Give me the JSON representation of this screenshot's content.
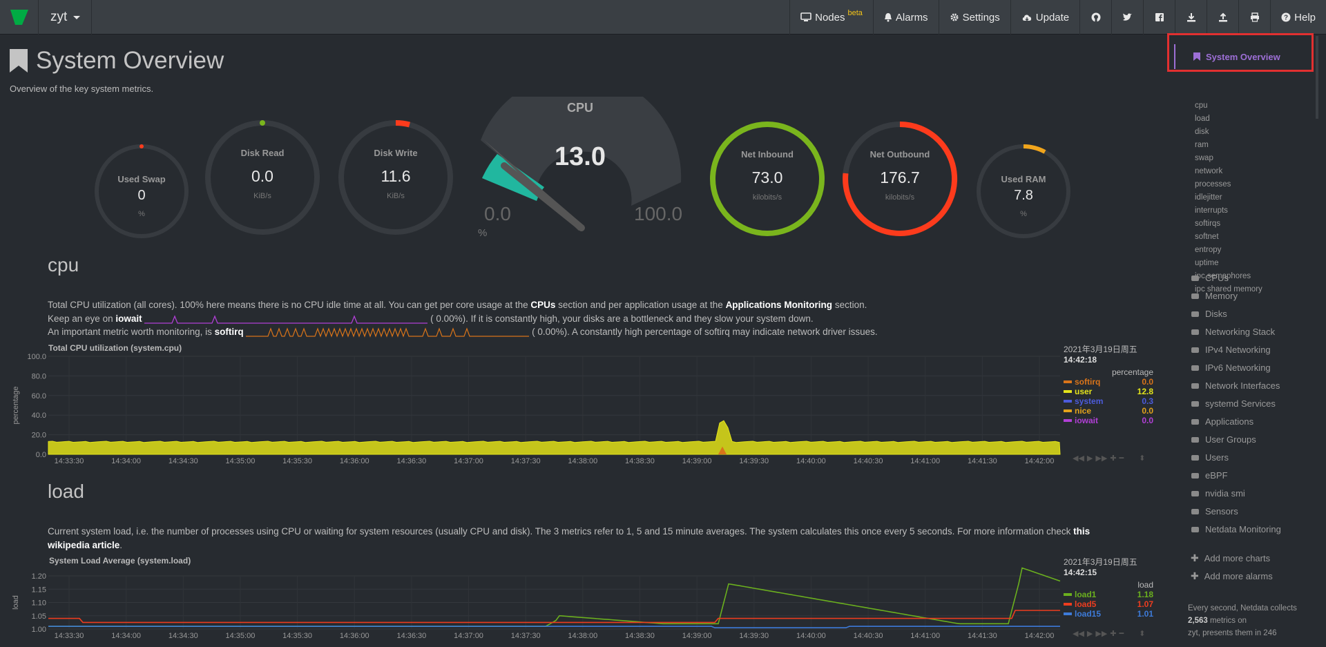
{
  "navbar": {
    "host": "zyt",
    "items": {
      "nodes": "Nodes",
      "nodes_badge": "beta",
      "alarms": "Alarms",
      "settings": "Settings",
      "update": "Update",
      "help": "Help"
    }
  },
  "page": {
    "title": "System Overview",
    "subtitle": "Overview of the key system metrics."
  },
  "gauges": {
    "used_swap": {
      "label": "Used Swap",
      "value": "0",
      "unit": "%"
    },
    "disk_read": {
      "label": "Disk Read",
      "value": "0.0",
      "unit": "KiB/s"
    },
    "disk_write": {
      "label": "Disk Write",
      "value": "11.6",
      "unit": "KiB/s"
    },
    "cpu": {
      "label": "CPU",
      "value": "13.0",
      "min": "0.0",
      "max": "100.0",
      "unit": "%",
      "level_percent": 13
    },
    "net_inbound": {
      "label": "Net Inbound",
      "value": "73.0",
      "unit": "kilobits/s"
    },
    "net_outbound": {
      "label": "Net Outbound",
      "value": "176.7",
      "unit": "kilobits/s"
    },
    "used_ram": {
      "label": "Used RAM",
      "value": "7.8",
      "unit": "%"
    }
  },
  "cpu_section": {
    "heading": "cpu",
    "line1_a": "Total CPU utilization (all cores). 100% here means there is no CPU idle time at all. You can get per core usage at the ",
    "line1_link1": "CPUs",
    "line1_b": " section and per application usage at the ",
    "line1_link2": "Applications Monitoring",
    "line1_c": " section.",
    "line2_a": "Keep an eye on ",
    "line2_b": "iowait",
    "line2_c": "(       0.00%). If it is constantly high, your disks are a bottleneck and they slow your system down.",
    "line3_a": "An important metric worth monitoring, is ",
    "line3_b": "softirq",
    "line3_c": "(       0.00%). A constantly high percentage of softirq may indicate network driver issues."
  },
  "cpu_chart": {
    "title": "Total CPU utilization (system.cpu)",
    "ylabel": "percentage",
    "yticks": [
      "100.0",
      "80.0",
      "60.0",
      "40.0",
      "20.0",
      "0.0"
    ],
    "xticks": [
      "14:33:30",
      "14:34:00",
      "14:34:30",
      "14:35:00",
      "14:35:30",
      "14:36:00",
      "14:36:30",
      "14:37:00",
      "14:37:30",
      "14:38:00",
      "14:38:30",
      "14:39:00",
      "14:39:30",
      "14:40:00",
      "14:40:30",
      "14:41:00",
      "14:41:30",
      "14:42:00"
    ],
    "date": "2021年3月19日周五",
    "time": "14:42:18",
    "units": "percentage",
    "legend": [
      {
        "name": "softirq",
        "value": "0.0",
        "color": "#d9741a"
      },
      {
        "name": "user",
        "value": "12.8",
        "color": "#e3e31b"
      },
      {
        "name": "system",
        "value": "0.3",
        "color": "#4c5bdb"
      },
      {
        "name": "nice",
        "value": "0.0",
        "color": "#e3a31b"
      },
      {
        "name": "iowait",
        "value": "0.0",
        "color": "#b13fd6"
      }
    ]
  },
  "load_section": {
    "heading": "load",
    "line1_a": "Current system load, i.e. the number of processes using CPU or waiting for system resources (usually CPU and disk). The 3 metrics refer to 1, 5 and 15 minute averages. The system calculates this once every 5 seconds. For more information check ",
    "line1_link": "this",
    "line2_link": "wikipedia article",
    "line2_end": "."
  },
  "load_chart": {
    "title": "System Load Average (system.load)",
    "ylabel": "load",
    "yticks": [
      "1.20",
      "1.15",
      "1.10",
      "1.05",
      "1.00"
    ],
    "xticks": [
      "14:33:30",
      "14:34:00",
      "14:34:30",
      "14:35:00",
      "14:35:30",
      "14:36:00",
      "14:36:30",
      "14:37:00",
      "14:37:30",
      "14:38:00",
      "14:38:30",
      "14:39:00",
      "14:39:30",
      "14:40:00",
      "14:40:30",
      "14:41:00",
      "14:41:30",
      "14:42:00"
    ],
    "date": "2021年3月19日周五",
    "time": "14:42:15",
    "units": "load",
    "legend": [
      {
        "name": "load1",
        "value": "1.18",
        "color": "#6bb01e"
      },
      {
        "name": "load5",
        "value": "1.07",
        "color": "#ee3d1f"
      },
      {
        "name": "load15",
        "value": "1.01",
        "color": "#3d7bd9"
      }
    ]
  },
  "sidebar": {
    "active": "System Overview",
    "sub_items": [
      "cpu",
      "load",
      "disk",
      "ram",
      "swap",
      "network",
      "processes",
      "idlejitter",
      "interrupts",
      "softirqs",
      "softnet",
      "entropy",
      "uptime",
      "ipc semaphores",
      "ipc shared memory"
    ],
    "categories": [
      "CPUs",
      "Memory",
      "Disks",
      "Networking Stack",
      "IPv4 Networking",
      "IPv6 Networking",
      "Network Interfaces",
      "systemd Services",
      "Applications",
      "User Groups",
      "Users",
      "eBPF",
      "nvidia smi",
      "Sensors",
      "Netdata Monitoring"
    ],
    "add_charts": "Add more charts",
    "add_alarms": "Add more alarms",
    "footer_a": "Every second, Netdata collects ",
    "footer_b": "2,563",
    "footer_c": " metrics on",
    "footer_d": "zyt, presents them in 246"
  },
  "colors": {
    "background": "#272b30",
    "navbar": "#3a3f44",
    "accent": "#9d6fd6",
    "net_inbound": "#7ab51d",
    "net_outbound": "#fd3b1c",
    "cpu_fill": "#21b79f",
    "cpu_chart_fill": "#c5c51b"
  }
}
